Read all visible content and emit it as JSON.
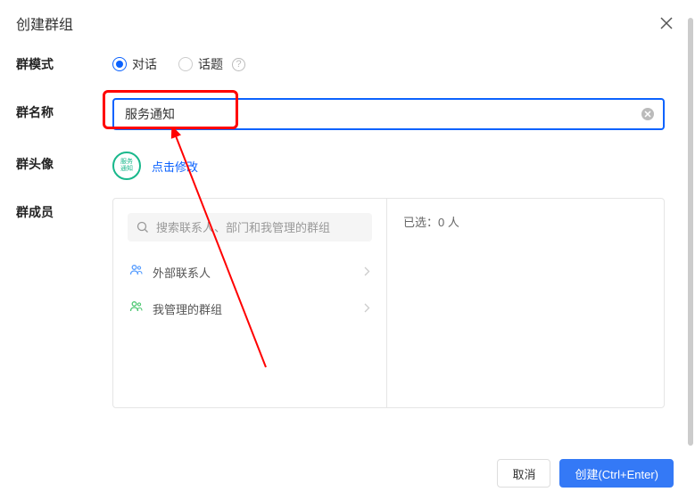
{
  "dialog": {
    "title": "创建群组"
  },
  "mode": {
    "label": "群模式",
    "option1": "对话",
    "option2": "话题"
  },
  "name": {
    "label": "群名称",
    "value": "服务通知"
  },
  "avatar": {
    "label": "群头像",
    "badge_line1": "服务",
    "badge_line2": "通知",
    "change_text": "点击修改"
  },
  "members": {
    "label": "群成员",
    "search_placeholder": "搜索联系人、部门和我管理的群组",
    "external_contacts": "外部联系人",
    "managed_groups": "我管理的群组",
    "selected_prefix": "已选：",
    "selected_count": "0",
    "selected_suffix": " 人"
  },
  "footer": {
    "cancel": "取消",
    "create": "创建(Ctrl+Enter)"
  }
}
